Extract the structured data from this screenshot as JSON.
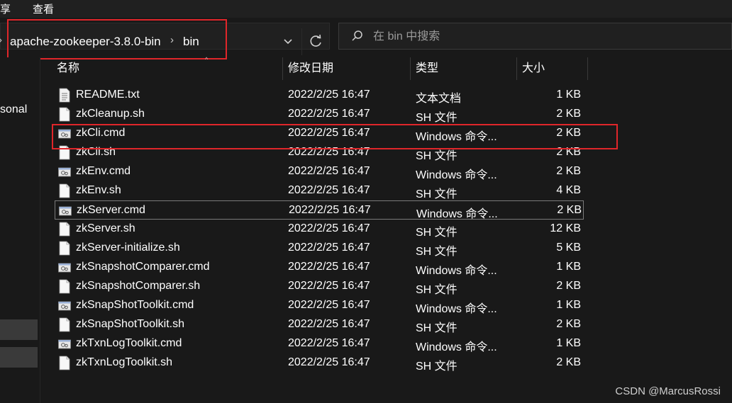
{
  "menu": {
    "items": [
      "享",
      "查看"
    ]
  },
  "address": {
    "breadcrumbs": [
      "apache-zookeeper-3.8.0-bin",
      "bin"
    ],
    "separator": "›"
  },
  "search": {
    "placeholder": "在 bin 中搜索"
  },
  "nav": {
    "visible_label": "sonal"
  },
  "columns": {
    "name": "名称",
    "date": "修改日期",
    "type": "类型",
    "size": "大小"
  },
  "files": [
    {
      "name": "README.txt",
      "date": "2022/2/25 16:47",
      "type": "文本文档",
      "size": "1 KB",
      "icon": "text-file-icon"
    },
    {
      "name": "zkCleanup.sh",
      "date": "2022/2/25 16:47",
      "type": "SH 文件",
      "size": "2 KB",
      "icon": "blank-file-icon"
    },
    {
      "name": "zkCli.cmd",
      "date": "2022/2/25 16:47",
      "type": "Windows 命令...",
      "size": "2 KB",
      "icon": "cmd-file-icon"
    },
    {
      "name": "zkCli.sh",
      "date": "2022/2/25 16:47",
      "type": "SH 文件",
      "size": "2 KB",
      "icon": "blank-file-icon"
    },
    {
      "name": "zkEnv.cmd",
      "date": "2022/2/25 16:47",
      "type": "Windows 命令...",
      "size": "2 KB",
      "icon": "cmd-file-icon"
    },
    {
      "name": "zkEnv.sh",
      "date": "2022/2/25 16:47",
      "type": "SH 文件",
      "size": "4 KB",
      "icon": "blank-file-icon"
    },
    {
      "name": "zkServer.cmd",
      "date": "2022/2/25 16:47",
      "type": "Windows 命令...",
      "size": "2 KB",
      "icon": "cmd-file-icon"
    },
    {
      "name": "zkServer.sh",
      "date": "2022/2/25 16:47",
      "type": "SH 文件",
      "size": "12 KB",
      "icon": "blank-file-icon"
    },
    {
      "name": "zkServer-initialize.sh",
      "date": "2022/2/25 16:47",
      "type": "SH 文件",
      "size": "5 KB",
      "icon": "blank-file-icon"
    },
    {
      "name": "zkSnapshotComparer.cmd",
      "date": "2022/2/25 16:47",
      "type": "Windows 命令...",
      "size": "1 KB",
      "icon": "cmd-file-icon"
    },
    {
      "name": "zkSnapshotComparer.sh",
      "date": "2022/2/25 16:47",
      "type": "SH 文件",
      "size": "2 KB",
      "icon": "blank-file-icon"
    },
    {
      "name": "zkSnapShotToolkit.cmd",
      "date": "2022/2/25 16:47",
      "type": "Windows 命令...",
      "size": "1 KB",
      "icon": "cmd-file-icon"
    },
    {
      "name": "zkSnapShotToolkit.sh",
      "date": "2022/2/25 16:47",
      "type": "SH 文件",
      "size": "2 KB",
      "icon": "blank-file-icon"
    },
    {
      "name": "zkTxnLogToolkit.cmd",
      "date": "2022/2/25 16:47",
      "type": "Windows 命令...",
      "size": "1 KB",
      "icon": "cmd-file-icon"
    },
    {
      "name": "zkTxnLogToolkit.sh",
      "date": "2022/2/25 16:47",
      "type": "SH 文件",
      "size": "2 KB",
      "icon": "blank-file-icon"
    }
  ],
  "watermark": "CSDN @MarcusRossi",
  "colors": {
    "background": "#191919",
    "highlight": "#e0262a",
    "text": "#ffffff"
  }
}
